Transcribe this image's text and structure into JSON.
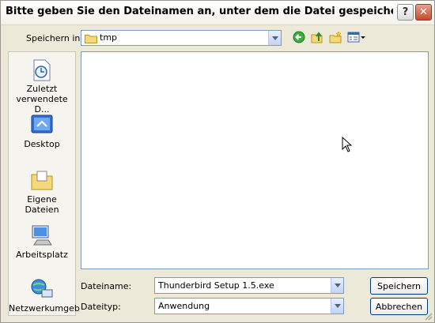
{
  "title": "Bitte geben Sie den Dateinamen an, unter dem die Datei gespeichert werden s...",
  "titlebar": {
    "help_glyph": "?",
    "close_glyph": "✕"
  },
  "save_in": {
    "label": "Speichern in:",
    "value": "tmp"
  },
  "toolbar": {
    "icons": [
      "back-icon",
      "up-folder-icon",
      "new-folder-icon",
      "view-menu-icon"
    ]
  },
  "places": [
    {
      "label": "Zuletzt verwendete D...",
      "icon": "recent-documents-icon"
    },
    {
      "label": "Desktop",
      "icon": "desktop-icon"
    },
    {
      "label": "Eigene Dateien",
      "icon": "my-documents-icon"
    },
    {
      "label": "Arbeitsplatz",
      "icon": "my-computer-icon"
    },
    {
      "label": "Netzwerkumgeb",
      "icon": "network-icon"
    }
  ],
  "filename": {
    "label": "Dateiname:",
    "value": "Thunderbird Setup 1.5.exe"
  },
  "filetype": {
    "label": "Dateityp:",
    "value": "Anwendung"
  },
  "buttons": {
    "save": "Speichern",
    "cancel": "Abbrechen"
  },
  "colors": {
    "dialog_bg": "#ece9d8",
    "accent_blue": "#7f9db9",
    "close_red": "#c54a2a"
  }
}
